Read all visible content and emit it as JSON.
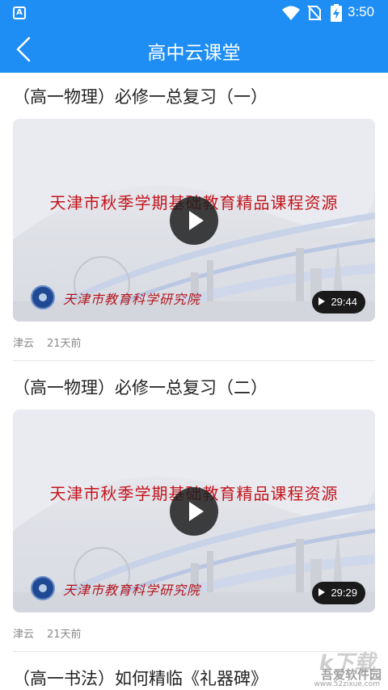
{
  "status_bar": {
    "app_badge": "A",
    "time": "3:50",
    "icons": [
      "wifi-icon",
      "no-sim-icon",
      "battery-charging-icon"
    ]
  },
  "header": {
    "title": "高中云课堂",
    "back_icon": "chevron-left-icon",
    "color": "#1e8ef5"
  },
  "videos": [
    {
      "title": "（高一物理）必修一总复习（一）",
      "banner_text": "天津市秋季学期基础教育精品课程资源",
      "academy_text": "天津市教育科学研究院",
      "duration": "29:44",
      "source": "津云",
      "time_ago": "21天前"
    },
    {
      "title": "（高一物理）必修一总复习（二）",
      "banner_text": "天津市秋季学期基础教育精品课程资源",
      "academy_text": "天津市教育科学研究院",
      "duration": "29:29",
      "source": "津云",
      "time_ago": "21天前"
    },
    {
      "title": "（高一书法）如何精临《礼器碑》"
    }
  ],
  "watermark": {
    "big_text": "k下载",
    "cn_text": "吾爱软件园",
    "url_text": "www.52zixue.com"
  }
}
